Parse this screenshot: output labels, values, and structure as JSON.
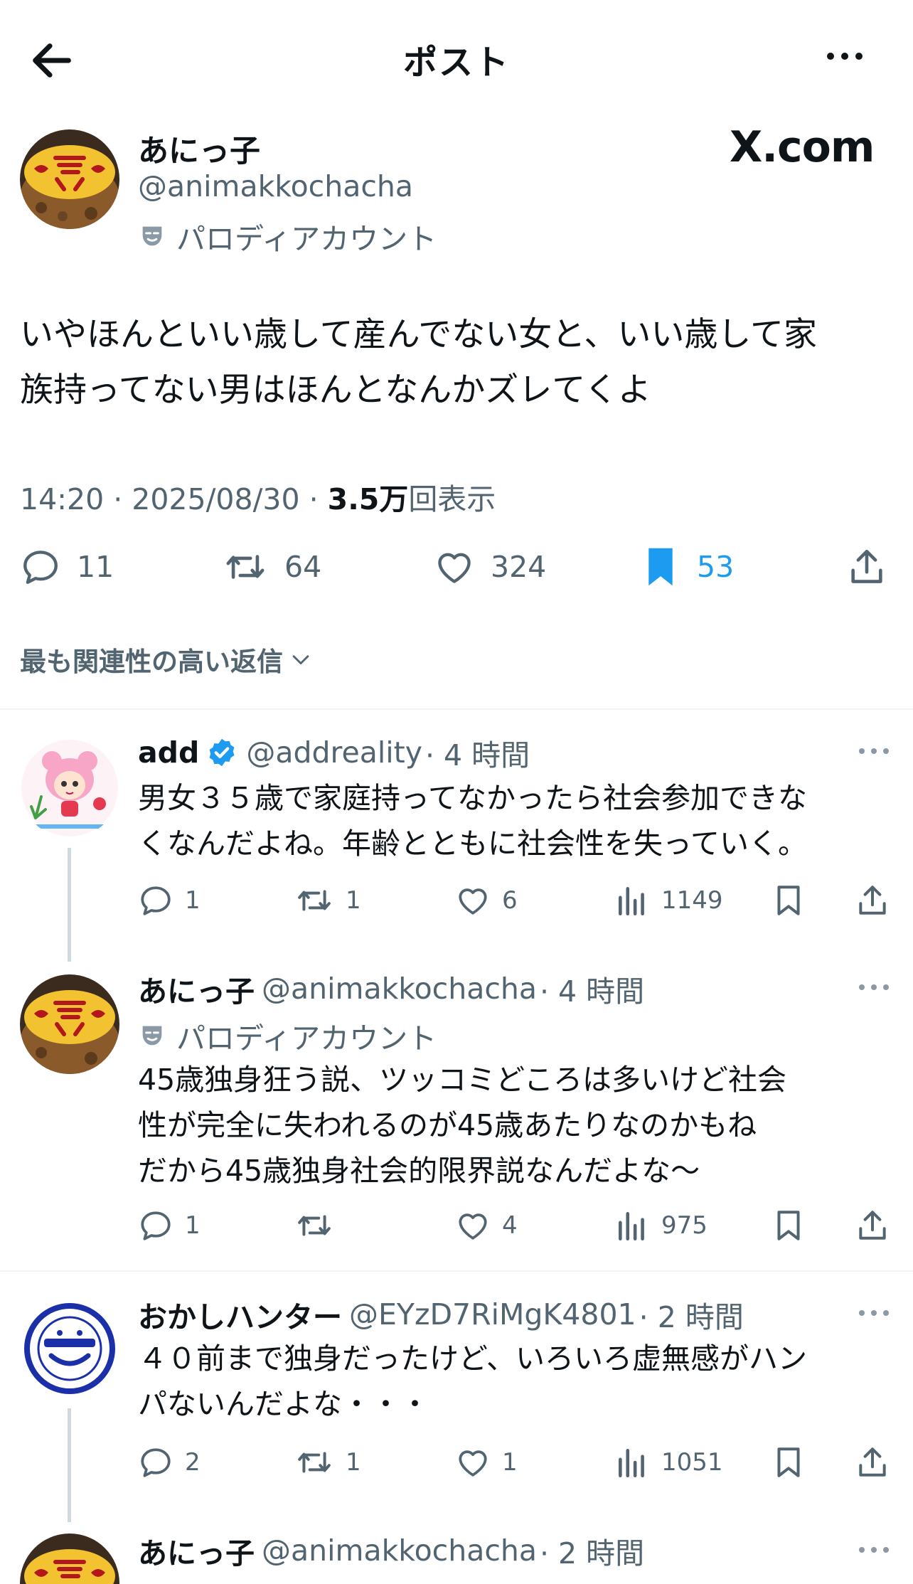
{
  "header": {
    "title": "ポスト",
    "back_icon": "arrow-left-icon",
    "more_icon": "more-horizontal-icon"
  },
  "post": {
    "author_name": "あにっ子",
    "author_handle": "@animakkochacha",
    "parody_label": "パロディアカウント",
    "watermark": "X.com",
    "text_line1": "いやほんといい歳して産んでない女と、いい歳して家",
    "text_line2": "族持ってない男はほんとなんかズレてくよ",
    "time": "14:20 · 2025/08/30 · ",
    "views_number": "3.5万",
    "views_label": "回表示",
    "replies": "11",
    "retweets": "64",
    "likes": "324",
    "bookmarks": "53",
    "accent_color": "#1d9bf0"
  },
  "sort_label": "最も関連性の高い返信",
  "replies": [
    {
      "name": "add",
      "verified": true,
      "handle": "@addreality",
      "time": "· 4 時間",
      "lines": [
        "男女３５歳で家庭持ってなかったら社会参加できな",
        "くなんだよね。年齢とともに社会性を失っていく。"
      ],
      "reply_count": "1",
      "retweet_count": "1",
      "like_count": "6",
      "view_count": "1149"
    },
    {
      "name": "あにっ子",
      "handle": "@animakkochacha",
      "time": "· 4 時間",
      "parody_label": "パロディアカウント",
      "lines": [
        "45歳独身狂う説、ツッコミどころは多いけど社会",
        "性が完全に失われるのが45歳あたりなのかもね",
        "だから45歳独身社会的限界説なんだよな〜"
      ],
      "reply_count": "1",
      "retweet_count": "",
      "like_count": "4",
      "view_count": "975"
    },
    {
      "name": "おかしハンター",
      "handle": "@EYzD7RiMgK4801",
      "time": "· 2 時間",
      "lines": [
        "４０前まで独身だったけど、いろいろ虚無感がハン",
        "パないんだよな・・・"
      ],
      "reply_count": "2",
      "retweet_count": "1",
      "like_count": "1",
      "view_count": "1051"
    },
    {
      "name": "あにっ子",
      "handle": "@animakkochacha",
      "time": "· 2 時間"
    }
  ]
}
